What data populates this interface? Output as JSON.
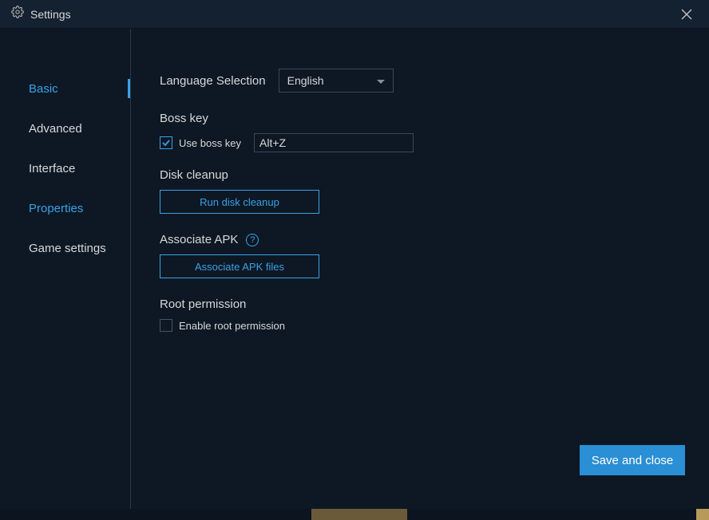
{
  "titlebar": {
    "icon": "gear-icon",
    "title": "Settings"
  },
  "sidebar": {
    "items": [
      {
        "label": "Basic",
        "active": true
      },
      {
        "label": "Advanced"
      },
      {
        "label": "Interface"
      },
      {
        "label": "Properties",
        "highlight": true
      },
      {
        "label": "Game settings"
      }
    ]
  },
  "content": {
    "language": {
      "label": "Language Selection",
      "value": "English"
    },
    "bosskey": {
      "title": "Boss key",
      "checkbox_label": "Use boss key",
      "checked": true,
      "shortcut": "Alt+Z"
    },
    "diskcleanup": {
      "title": "Disk cleanup",
      "button": "Run disk cleanup"
    },
    "associate_apk": {
      "title": "Associate APK",
      "button": "Associate APK files"
    },
    "root": {
      "title": "Root permission",
      "checkbox_label": "Enable root permission",
      "checked": false
    },
    "save_button": "Save and close"
  }
}
